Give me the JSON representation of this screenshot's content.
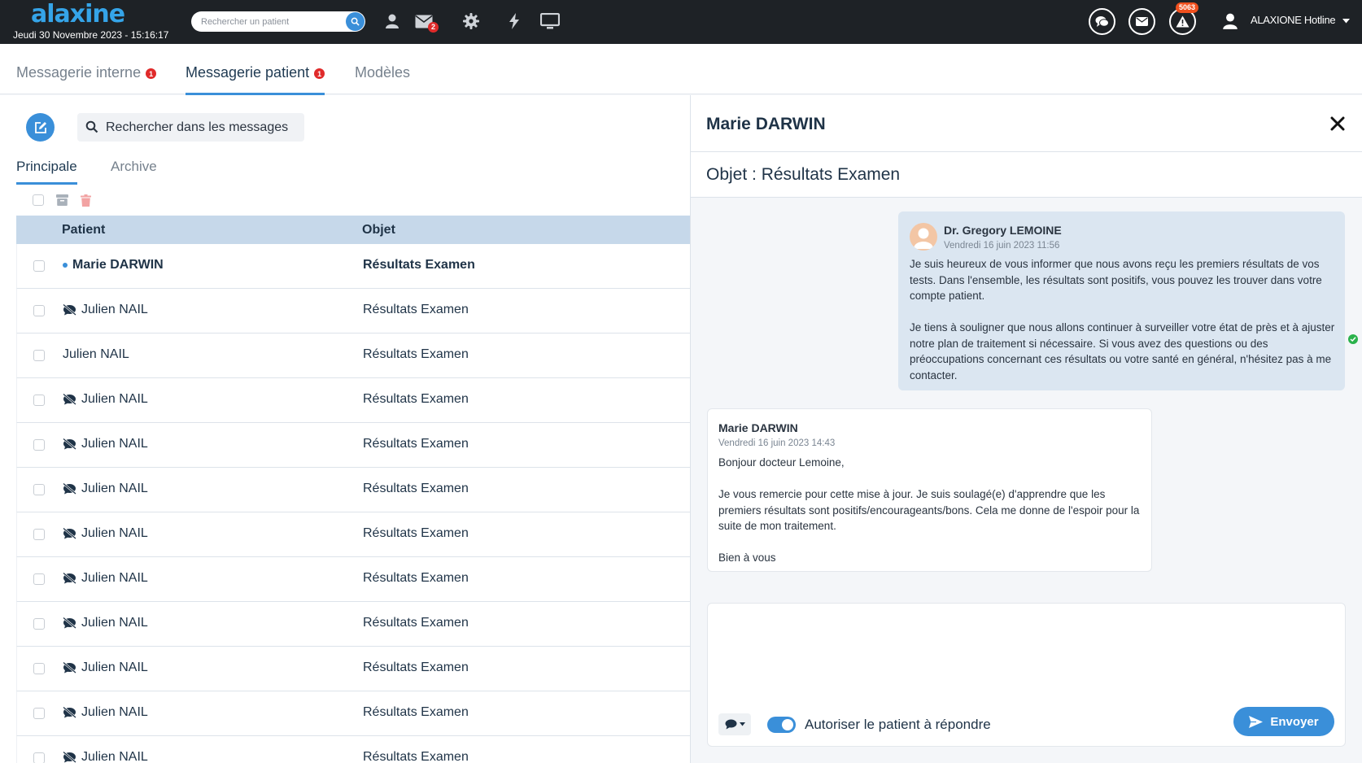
{
  "app": {
    "logo_text": "alaxi​ne",
    "datetime": "Jeudi 30 Novembre 2023 - 15:16:17"
  },
  "topbar": {
    "search_placeholder": "Rechercher un patient",
    "mail_badge": "2",
    "alert_badge": "5063",
    "user_name": "ALAXIONE Hotline"
  },
  "tabs": [
    {
      "label": "Messagerie interne",
      "badge": "1"
    },
    {
      "label": "Messagerie patient",
      "badge": "1"
    },
    {
      "label": "Modèles"
    }
  ],
  "inbox": {
    "search_placeholder": "Rechercher dans les messages",
    "subtabs": [
      "Principale",
      "Archive"
    ],
    "columns": {
      "patient": "Patient",
      "object": "Objet"
    },
    "rows": [
      {
        "patient": "Marie DARWIN",
        "object": "Résultats Examen",
        "status": "unread"
      },
      {
        "patient": "Julien NAIL",
        "object": "Résultats Examen",
        "status": "muted"
      },
      {
        "patient": "Julien NAIL",
        "object": "Résultats Examen",
        "status": "none"
      },
      {
        "patient": "Julien NAIL",
        "object": "Résultats Examen",
        "status": "muted"
      },
      {
        "patient": "Julien NAIL",
        "object": "Résultats Examen",
        "status": "muted"
      },
      {
        "patient": "Julien NAIL",
        "object": "Résultats Examen",
        "status": "muted"
      },
      {
        "patient": "Julien NAIL",
        "object": "Résultats Examen",
        "status": "muted"
      },
      {
        "patient": "Julien NAIL",
        "object": "Résultats Examen",
        "status": "muted"
      },
      {
        "patient": "Julien NAIL",
        "object": "Résultats Examen",
        "status": "muted"
      },
      {
        "patient": "Julien NAIL",
        "object": "Résultats Examen",
        "status": "muted"
      },
      {
        "patient": "Julien NAIL",
        "object": "Résultats Examen",
        "status": "muted"
      },
      {
        "patient": "Julien NAIL",
        "object": "Résultats Examen",
        "status": "muted"
      }
    ]
  },
  "conversation": {
    "patient_name": "Marie DARWIN",
    "subject": "Objet : Résultats Examen",
    "messages": [
      {
        "sender": "Dr. Gregory LEMOINE",
        "date": "Vendredi 16 juin 2023 11:56",
        "body": "Je suis heureux de vous informer que nous avons reçu les premiers résultats de vos tests. Dans l'ensemble, les résultats sont positifs, vous pouvez les trouver dans votre compte patient.\n\nJe tiens à souligner que nous allons continuer à surveiller votre état de près et à ajuster notre plan de traitement si nécessaire. Si vous avez des questions ou des préoccupations concernant ces résultats ou votre santé en général, n'hésitez pas à me contacter."
      },
      {
        "sender": "Marie DARWIN",
        "date": "Vendredi 16 juin 2023 14:43",
        "body": "Bonjour docteur Lemoine,\n\nJe vous remercie pour cette mise à jour. Je suis soulagé(e) d'apprendre que les premiers résultats sont positifs/encourageants/bons. Cela me donne de l'espoir pour la suite de mon traitement.\n\nBien à vous"
      }
    ],
    "composer": {
      "allow_reply_label": "Autoriser le patient à répondre",
      "send_label": "Envoyer"
    }
  },
  "colors": {
    "accent": "#3a8fd9",
    "topbar": "#1e2226",
    "badge": "#e02a2a",
    "table_header": "#c6d8ea",
    "doctor_bubble": "#dbe6f1"
  }
}
